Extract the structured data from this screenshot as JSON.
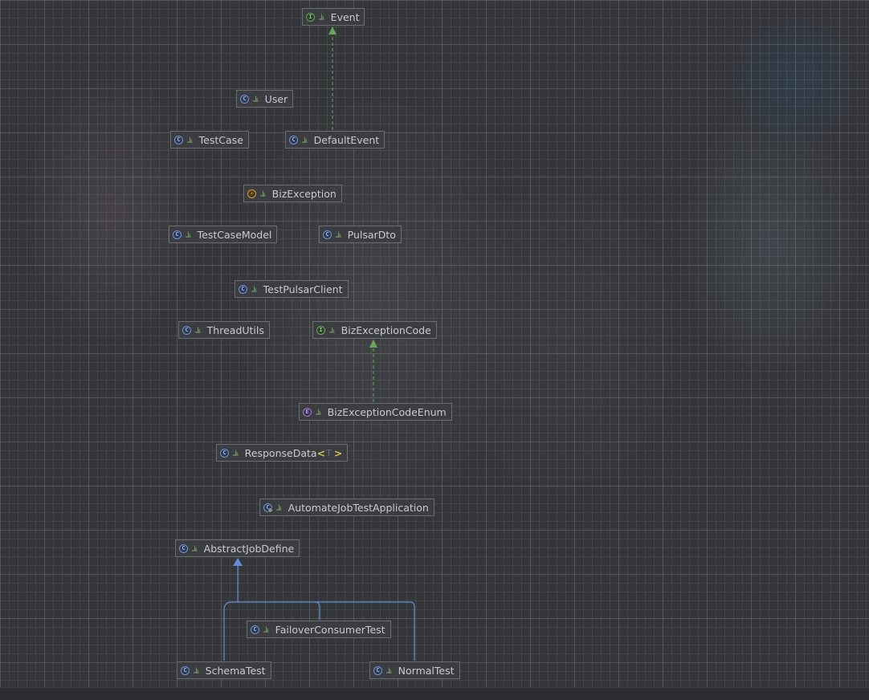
{
  "diagram": {
    "nodes": [
      {
        "id": "event",
        "kind": "interface",
        "badge": "I",
        "name": "Event"
      },
      {
        "id": "user",
        "kind": "class",
        "badge": "C",
        "name": "User"
      },
      {
        "id": "testcase",
        "kind": "class",
        "badge": "C",
        "name": "TestCase"
      },
      {
        "id": "defaultevent",
        "kind": "class",
        "badge": "C",
        "name": "DefaultEvent"
      },
      {
        "id": "bizexception",
        "kind": "exception",
        "badge": "⚡",
        "name": "BizException"
      },
      {
        "id": "testcasemodel",
        "kind": "class",
        "badge": "C",
        "name": "TestCaseModel"
      },
      {
        "id": "pulsardto",
        "kind": "class",
        "badge": "C",
        "name": "PulsarDto"
      },
      {
        "id": "testpulsarclient",
        "kind": "class",
        "badge": "C",
        "name": "TestPulsarClient"
      },
      {
        "id": "threadutils",
        "kind": "class",
        "badge": "C",
        "name": "ThreadUtils"
      },
      {
        "id": "bizexceptioncode",
        "kind": "interface",
        "badge": "I",
        "name": "BizExceptionCode"
      },
      {
        "id": "bizexceptioncodeenum",
        "kind": "enum",
        "badge": "E",
        "name": "BizExceptionCodeEnum"
      },
      {
        "id": "responsedata",
        "kind": "class",
        "badge": "C",
        "name": "ResponseData",
        "type_param_open": "<",
        "type_param": "T",
        "type_param_close": ">"
      },
      {
        "id": "automatejobtestapplication",
        "kind": "annotated",
        "badge": "C",
        "name": "AutomateJobTestApplication"
      },
      {
        "id": "abstractjobdefine",
        "kind": "class",
        "badge": "C",
        "name": "AbstractJobDefine"
      },
      {
        "id": "failoverconsumertest",
        "kind": "class",
        "badge": "C",
        "name": "FailoverConsumerTest"
      },
      {
        "id": "schematest",
        "kind": "class",
        "badge": "C",
        "name": "SchemaTest"
      },
      {
        "id": "normaltest",
        "kind": "class",
        "badge": "C",
        "name": "NormalTest"
      }
    ],
    "visibility_icon": "⫡",
    "edges": [
      {
        "from": "defaultevent",
        "to": "event",
        "type": "implements"
      },
      {
        "from": "bizexceptioncodeenum",
        "to": "bizexceptioncode",
        "type": "implements"
      },
      {
        "from": "failoverconsumertest",
        "to": "abstractjobdefine",
        "type": "extends"
      },
      {
        "from": "schematest",
        "to": "abstractjobdefine",
        "type": "extends"
      },
      {
        "from": "normaltest",
        "to": "abstractjobdefine",
        "type": "extends"
      }
    ],
    "colors": {
      "implements_edge": "#6aa55c",
      "extends_edge": "#5e8fd8",
      "node_border": "#6b6d70",
      "node_fill": "#3b3d40"
    }
  }
}
